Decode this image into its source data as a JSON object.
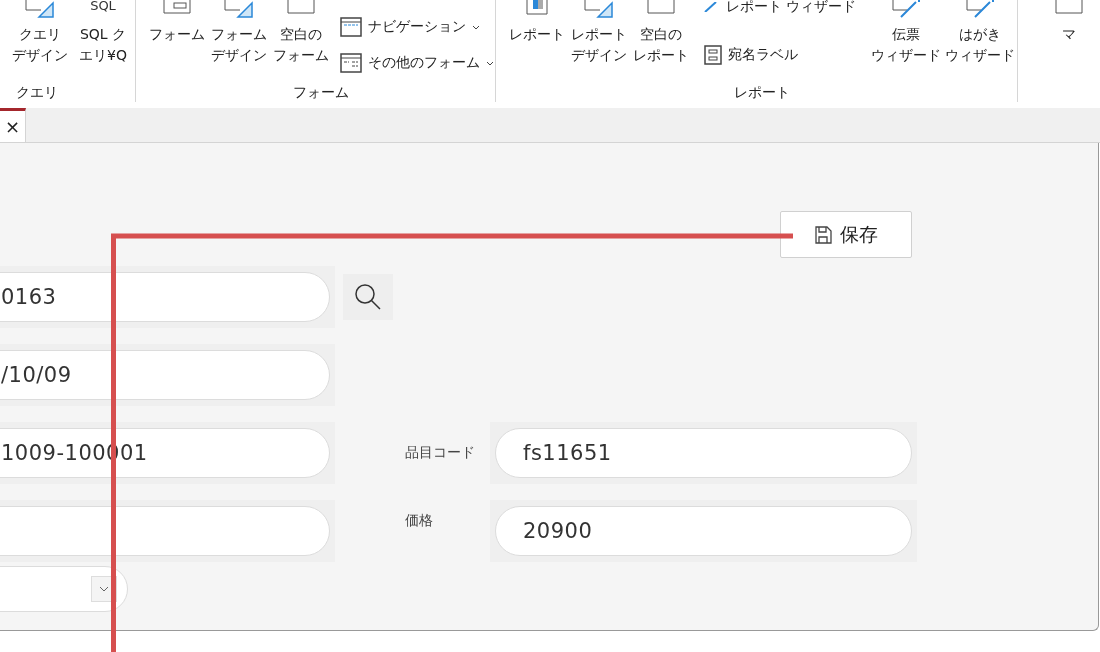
{
  "ribbon": {
    "groups": [
      {
        "label": "クエリ",
        "items": [
          {
            "kind": "large",
            "lines": [
              "クエリ",
              "デザイン"
            ]
          },
          {
            "kind": "large",
            "icon_text": "SQL",
            "lines": [
              "SQL ク",
              "エリ¥Q"
            ]
          }
        ]
      },
      {
        "label": "フォーム",
        "items": [
          {
            "kind": "large",
            "lines": [
              "フォーム"
            ]
          },
          {
            "kind": "large",
            "lines": [
              "フォーム",
              "デザイン"
            ]
          },
          {
            "kind": "large",
            "lines": [
              "空白の",
              "フォーム"
            ]
          },
          {
            "kind": "stack",
            "entries": [
              {
                "label": "ナビゲーション",
                "dropdown": true
              },
              {
                "label": "その他のフォーム",
                "dropdown": true
              }
            ]
          }
        ]
      },
      {
        "label": "レポート",
        "items": [
          {
            "kind": "large",
            "lines": [
              "レポート"
            ]
          },
          {
            "kind": "large",
            "lines": [
              "レポート",
              "デザイン"
            ]
          },
          {
            "kind": "large",
            "lines": [
              "空白の",
              "レポート"
            ]
          },
          {
            "kind": "stack",
            "entries": [
              {
                "label": "レポート ウィザード",
                "dropdown": false
              },
              {
                "label": "宛名ラベル",
                "dropdown": false
              }
            ]
          },
          {
            "kind": "large",
            "lines": [
              "伝票",
              "ウィザード"
            ]
          },
          {
            "kind": "large",
            "lines": [
              "はがき",
              "ウィザード"
            ]
          }
        ]
      },
      {
        "items": [
          {
            "kind": "large",
            "lines": [
              "マ"
            ]
          }
        ]
      }
    ]
  },
  "document_tab": {
    "close": "×",
    "selected": true
  },
  "form": {
    "save_button": "保存",
    "left_fields": [
      {
        "value": "0163",
        "search": true
      },
      {
        "value": "/10/09",
        "search": false
      },
      {
        "value": "1009-100001",
        "search": false
      },
      {
        "search": false
      }
    ],
    "right_fields": [
      {
        "label": "品目コード",
        "value": "fs11651"
      },
      {
        "label": "価格",
        "value": "20900"
      }
    ]
  }
}
